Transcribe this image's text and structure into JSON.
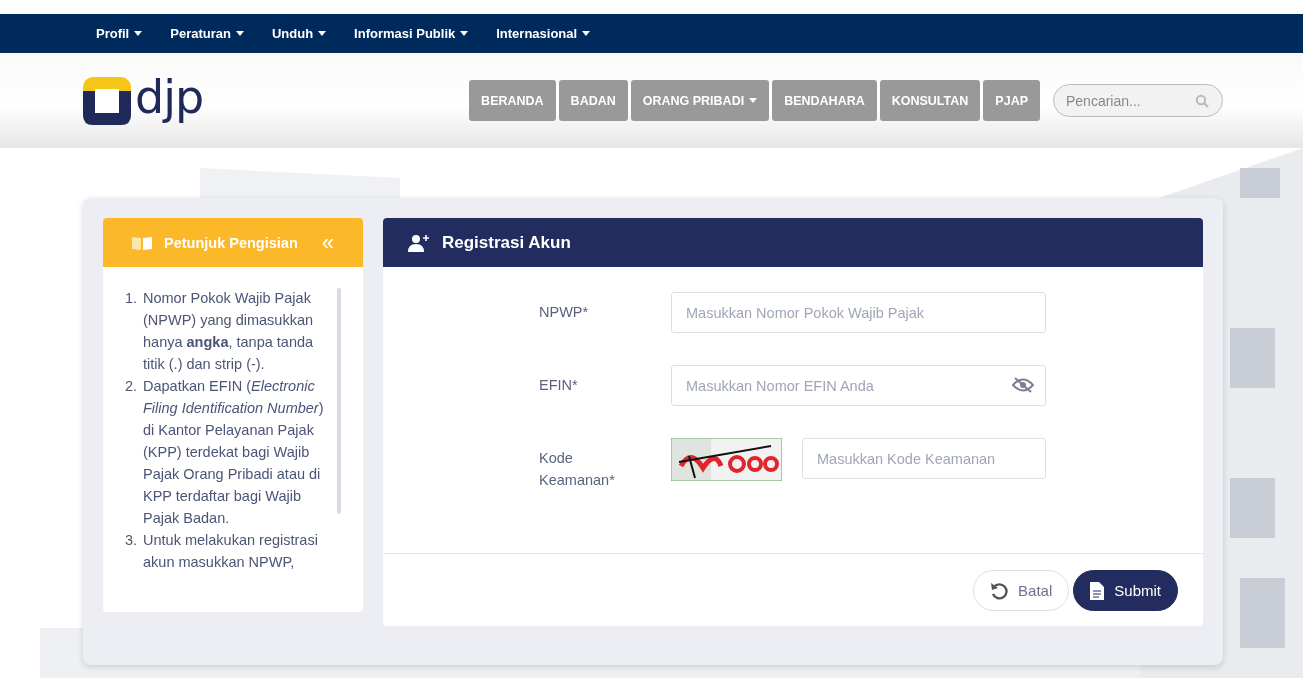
{
  "top_menu": [
    {
      "label": "Profil"
    },
    {
      "label": "Peraturan"
    },
    {
      "label": "Unduh"
    },
    {
      "label": "Informasi Publik"
    },
    {
      "label": "Internasional"
    }
  ],
  "header": {
    "logo_text": "djp",
    "nav": [
      {
        "label": "BERANDA",
        "has_dropdown": false
      },
      {
        "label": "BADAN",
        "has_dropdown": false
      },
      {
        "label": "ORANG PRIBADI",
        "has_dropdown": true
      },
      {
        "label": "BENDAHARA",
        "has_dropdown": false
      },
      {
        "label": "KONSULTAN",
        "has_dropdown": false
      },
      {
        "label": "PJAP",
        "has_dropdown": false
      }
    ],
    "search": {
      "placeholder": "Pencarian..."
    }
  },
  "guide": {
    "title": "Petunjuk Pengisian",
    "collapse": "«",
    "items": [
      {
        "number": "1.",
        "text": "Nomor Pokok Wajib Pajak (NPWP) yang dimasukkan hanya **angka**, tanpa tanda titik (.) dan strip (-)."
      },
      {
        "number": "2.",
        "text": "Dapatkan EFIN (*Electronic Filing Identification Number*) di Kantor Pelayanan Pajak (KPP) terdekat bagi Wajib Pajak Orang Pribadi atau di KPP terdaftar bagi Wajib Pajak Badan."
      },
      {
        "number": "3.",
        "text": "Untuk melakukan registrasi akun masukkan NPWP,"
      }
    ]
  },
  "form": {
    "title": "Registrasi Akun",
    "fields": [
      {
        "kind": "text",
        "label": "NPWP*",
        "placeholder": "Masukkan Nomor Pokok Wajib Pajak"
      },
      {
        "kind": "password",
        "label": "EFIN*",
        "placeholder": "Masukkan Nomor EFIN Anda"
      },
      {
        "kind": "captcha",
        "label": "Kode Keamanan*",
        "placeholder": "Masukkan Kode Keamanan"
      }
    ],
    "buttons": [
      {
        "kind": "secondary",
        "label": "Batal"
      },
      {
        "kind": "primary",
        "label": "Submit"
      }
    ]
  }
}
